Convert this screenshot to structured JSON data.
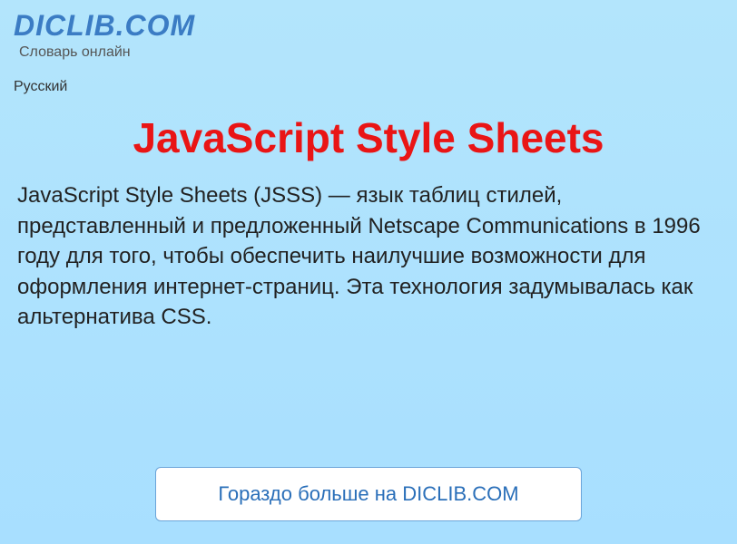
{
  "header": {
    "site_title": "DICLIB.COM",
    "site_subtitle": "Словарь онлайн"
  },
  "language": {
    "current": "Русский"
  },
  "article": {
    "title": "JavaScript Style Sheets",
    "body": "JavaScript Style Sheets (JSSS) — язык таблиц стилей, представленный и предложенный Netscape Communications в 1996 году для того, чтобы обеспечить наилучшие возможности для оформления интернет-страниц. Эта технология задумывалась как альтернатива CSS."
  },
  "cta": {
    "label": "Гораздо больше на DICLIB.COM"
  }
}
